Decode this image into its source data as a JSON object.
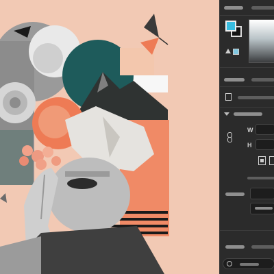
{
  "panel": {
    "fill_color": "#38bde0",
    "stroke_color": "#111111",
    "dimension_labels": {
      "width": "W",
      "height": "H"
    },
    "icons": [
      "swatch-icon",
      "warning-icon",
      "page-icon",
      "chevron-down-icon",
      "link-icon",
      "align-icon",
      "search-icon"
    ]
  },
  "colors": {
    "canvas_bg": "#f2c9b4",
    "accent_orange": "#f07a56",
    "teal": "#1f5a5a",
    "panel_bg": "#2b2b2b"
  }
}
